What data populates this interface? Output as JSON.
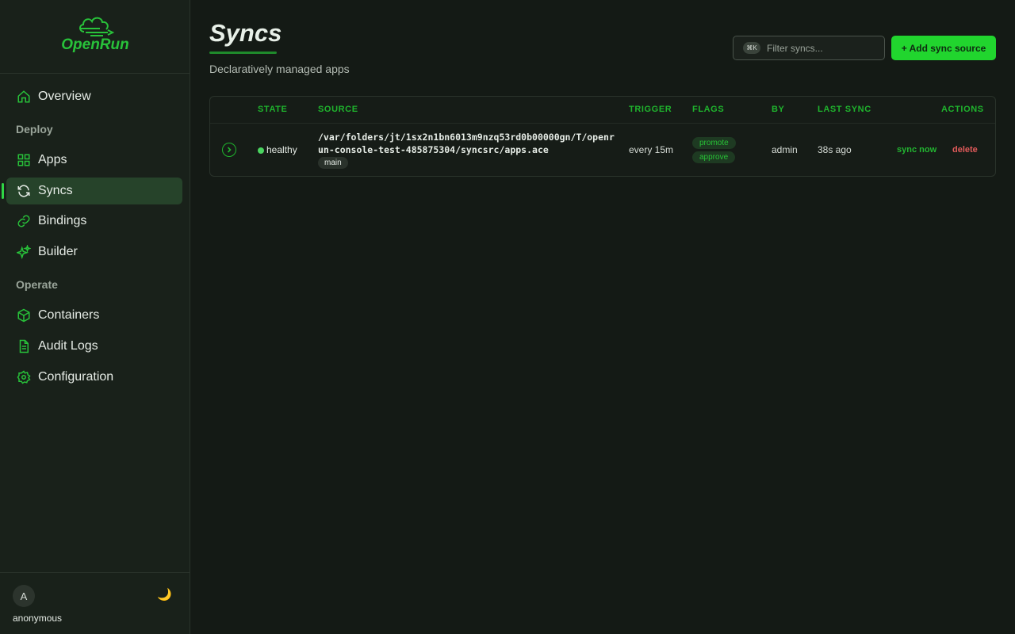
{
  "app": {
    "logo_text": "OpenRun",
    "logo_icon": "cloud-run-icon"
  },
  "sidebar": {
    "overview": {
      "label": "Overview",
      "icon": "home-icon"
    },
    "sections": {
      "deploy": "Deploy",
      "operate": "Operate"
    },
    "deploy_items": [
      {
        "label": "Apps",
        "icon": "grid-icon"
      },
      {
        "label": "Syncs",
        "icon": "refresh-icon",
        "active": true
      },
      {
        "label": "Bindings",
        "icon": "link-icon"
      },
      {
        "label": "Builder",
        "icon": "sparkle-icon"
      }
    ],
    "operate_items": [
      {
        "label": "Containers",
        "icon": "cube-icon"
      },
      {
        "label": "Audit Logs",
        "icon": "document-icon"
      },
      {
        "label": "Configuration",
        "icon": "gear-icon"
      }
    ],
    "footer": {
      "avatar_initial": "A",
      "username": "anonymous",
      "theme_icon": "🌙"
    }
  },
  "header": {
    "title": "Syncs",
    "subtitle": "Declaratively managed apps",
    "filter": {
      "shortcut": "⌘K",
      "placeholder": "Filter syncs..."
    },
    "add_button": "+ Add sync source"
  },
  "table": {
    "columns": {
      "state": "STATE",
      "source": "SOURCE",
      "trigger": "TRIGGER",
      "flags": "FLAGS",
      "by": "BY",
      "last_sync": "LAST SYNC",
      "actions": "ACTIONS"
    },
    "rows": [
      {
        "state": "healthy",
        "source": "/var/folders/jt/1sx2n1bn6013m9nzq53rd0b00000gn/T/openrun-console-test-485875304/syncsrc/apps.ace",
        "branch": "main",
        "trigger": "every 15m",
        "flags": [
          "promote",
          "approve"
        ],
        "by": "admin",
        "last_sync": "38s ago",
        "actions": {
          "sync": "sync now",
          "delete": "delete"
        }
      }
    ]
  },
  "colors": {
    "accent": "#21d52e",
    "background": "#141a15",
    "sidebar": "#19211a",
    "active_nav": "#26432a",
    "danger": "#e05a5a",
    "healthy": "#4ad460"
  }
}
